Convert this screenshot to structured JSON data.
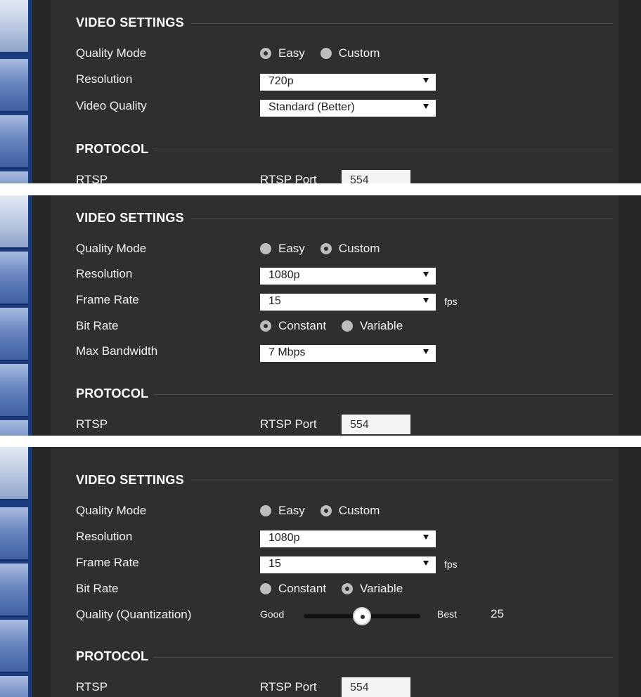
{
  "panels": [
    {
      "section_title": "VIDEO SETTINGS",
      "quality_mode": {
        "label": "Quality Mode",
        "options": [
          "Easy",
          "Custom"
        ],
        "selected": "Easy"
      },
      "resolution": {
        "label": "Resolution",
        "value": "720p"
      },
      "video_quality": {
        "label": "Video Quality",
        "value": "Standard (Better)"
      },
      "protocol": {
        "title": "PROTOCOL",
        "rtsp_label": "RTSP",
        "port_label": "RTSP Port",
        "port_value": "554"
      }
    },
    {
      "section_title": "VIDEO SETTINGS",
      "quality_mode": {
        "label": "Quality Mode",
        "options": [
          "Easy",
          "Custom"
        ],
        "selected": "Custom"
      },
      "resolution": {
        "label": "Resolution",
        "value": "1080p"
      },
      "frame_rate": {
        "label": "Frame Rate",
        "value": "15",
        "unit": "fps"
      },
      "bit_rate": {
        "label": "Bit Rate",
        "options": [
          "Constant",
          "Variable"
        ],
        "selected": "Constant"
      },
      "max_bandwidth": {
        "label": "Max Bandwidth",
        "value": "7 Mbps"
      },
      "protocol": {
        "title": "PROTOCOL",
        "rtsp_label": "RTSP",
        "port_label": "RTSP Port",
        "port_value": "554"
      }
    },
    {
      "section_title": "VIDEO SETTINGS",
      "quality_mode": {
        "label": "Quality Mode",
        "options": [
          "Easy",
          "Custom"
        ],
        "selected": "Custom"
      },
      "resolution": {
        "label": "Resolution",
        "value": "1080p"
      },
      "frame_rate": {
        "label": "Frame Rate",
        "value": "15",
        "unit": "fps"
      },
      "bit_rate": {
        "label": "Bit Rate",
        "options": [
          "Constant",
          "Variable"
        ],
        "selected": "Variable"
      },
      "quantization": {
        "label": "Quality (Quantization)",
        "min_label": "Good",
        "max_label": "Best",
        "value": "25",
        "position_fraction": 0.5
      },
      "protocol": {
        "title": "PROTOCOL",
        "rtsp_label": "RTSP",
        "port_label": "RTSP Port",
        "port_value": "554"
      }
    }
  ],
  "colors": {
    "panel_bg": "#2f2f2f",
    "nav_blue": "#1a3d80",
    "text": "#f2f2f2"
  }
}
